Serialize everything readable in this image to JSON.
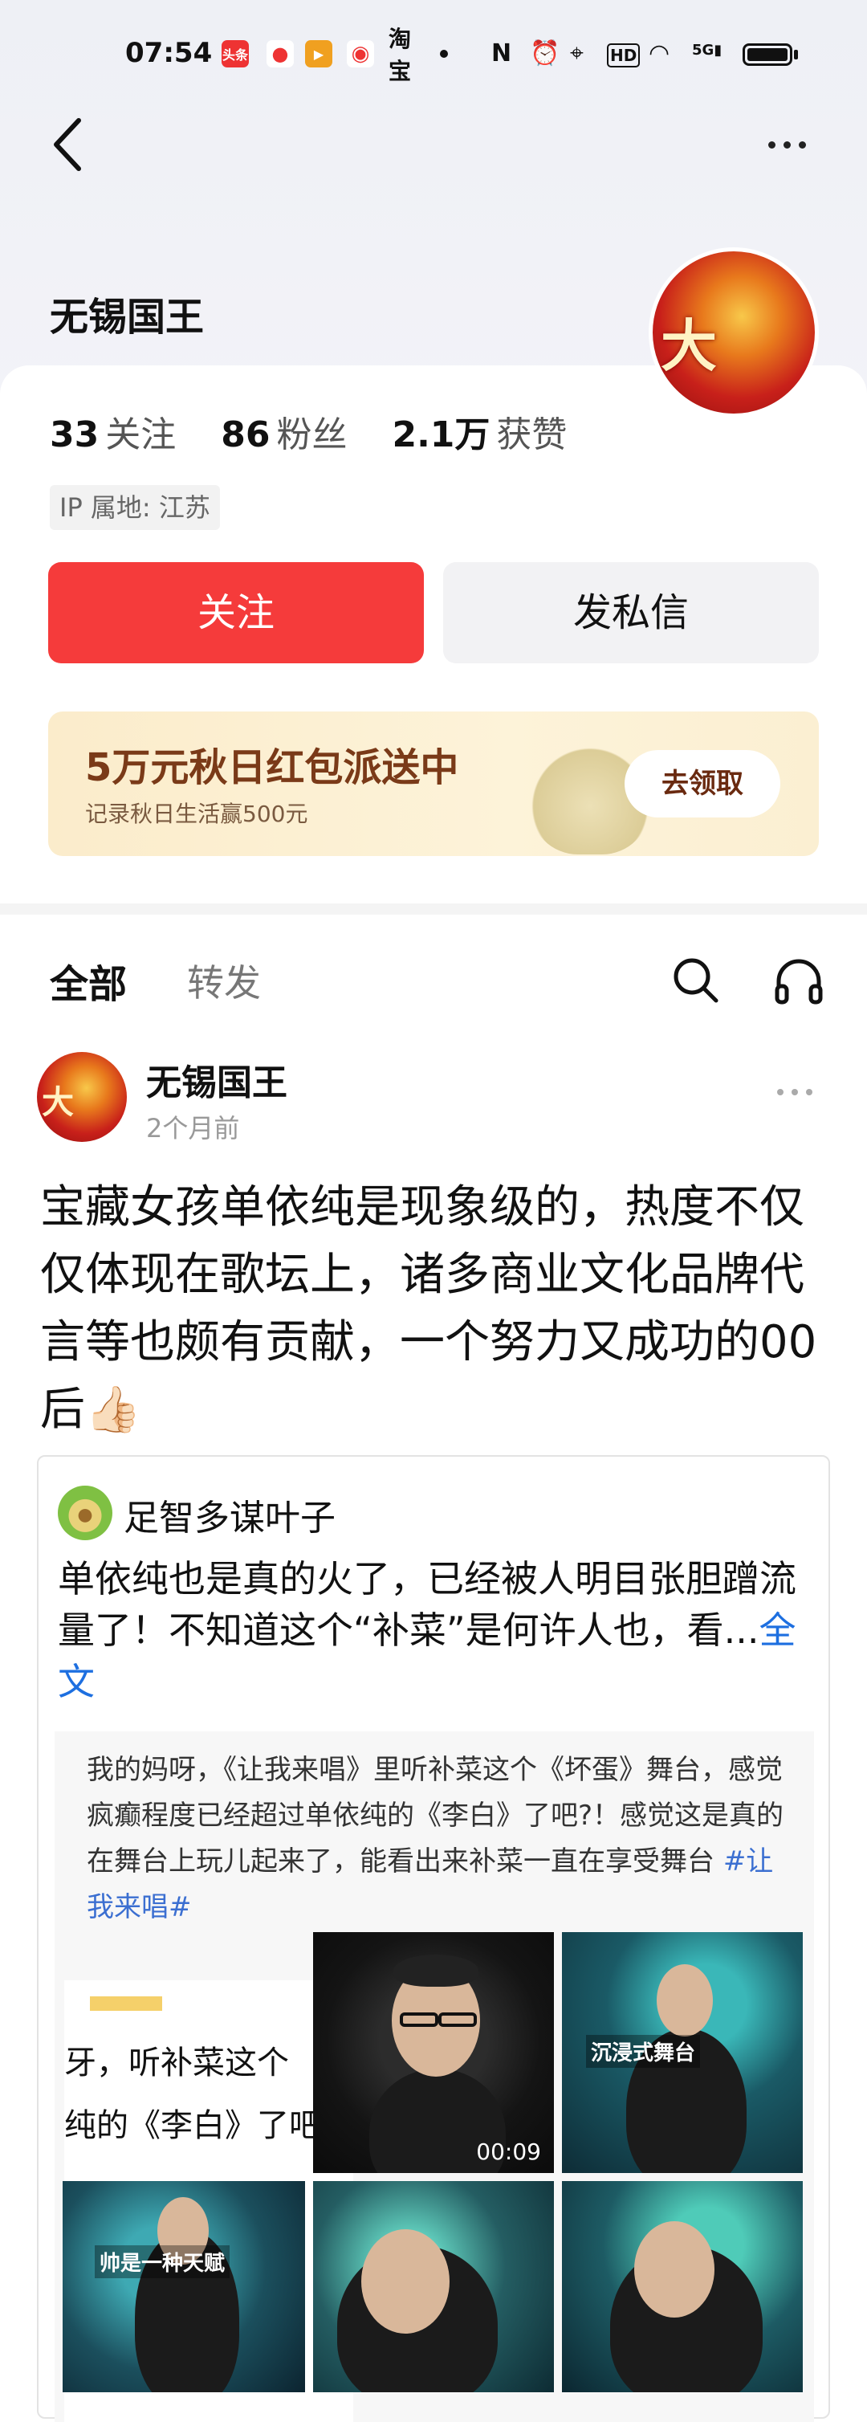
{
  "status_bar": {
    "time": "07:54",
    "apps": [
      "头条",
      "地图",
      "视频",
      "微博",
      "淘宝"
    ],
    "icons": [
      "nfc-icon",
      "alarm-icon",
      "location-icon",
      "hd-icon",
      "wifi-icon",
      "5g-signal-icon",
      "battery-icon"
    ],
    "net": "5G"
  },
  "nav": {
    "back_icon": "back-arrow-icon",
    "more_icon": "more-icon"
  },
  "profile": {
    "name": "无锡国王",
    "avatar_text": "大",
    "following_count": "33",
    "following_label": "关注",
    "followers_count": "86",
    "followers_label": "粉丝",
    "likes_count": "2.1万",
    "likes_label": "获赞",
    "ip": "IP 属地: 江苏",
    "follow_button": "关注",
    "message_button": "发私信"
  },
  "promo": {
    "title": "5万元秋日红包派送中",
    "subtitle": "记录秋日生活赢500元",
    "button": "去领取"
  },
  "tabs": [
    {
      "label": "全部",
      "active": true
    },
    {
      "label": "转发",
      "active": false
    }
  ],
  "post": {
    "author": "无锡国王",
    "time": "2个月前",
    "text": "宝藏女孩单依纯是现象级的，热度不仅仅体现在歌坛上，诸多商业文化品牌代言等也颇有贡献，一个努力又成功的00后",
    "emoji": "👍🏻",
    "quoted": {
      "user": "足智多谋叶子",
      "text": "单依纯也是真的火了，已经被人明目张胆蹭流量了！不知道这个“补菜”是何许人也，看...",
      "more_link": "全文",
      "inner_text": "我的妈呀，《让我来唱》里听补菜这个《坏蛋》舞台，感觉疯癫程度已经超过单依纯的《李白》了吧?！感觉这是真的在舞台上玩儿起来了，能看出来补菜一直在享受舞台 ",
      "inner_tag": "#让我来唱#",
      "strip_line1": "牙，听补菜这个",
      "strip_line2": "纯的《李白》了吧",
      "video_duration": "00:09",
      "caption_immersive": "沉浸式舞台",
      "caption_talent": "帅是一种天赋"
    }
  },
  "colors": {
    "follow_red": "#f53b3b",
    "link_blue": "#1d6fe0",
    "promo_brown": "#7a3a18"
  }
}
